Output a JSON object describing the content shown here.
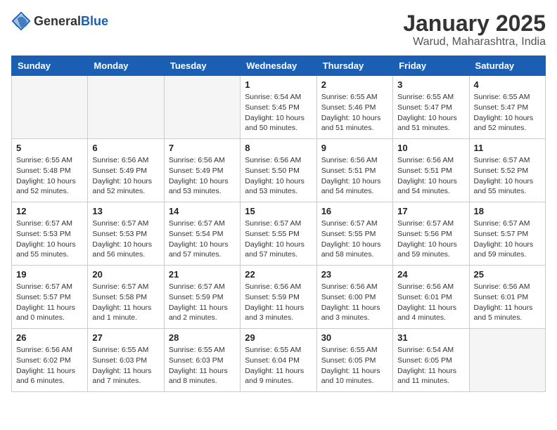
{
  "header": {
    "logo_general": "General",
    "logo_blue": "Blue",
    "title": "January 2025",
    "subtitle": "Warud, Maharashtra, India"
  },
  "weekdays": [
    "Sunday",
    "Monday",
    "Tuesday",
    "Wednesday",
    "Thursday",
    "Friday",
    "Saturday"
  ],
  "weeks": [
    [
      {
        "day": "",
        "info": ""
      },
      {
        "day": "",
        "info": ""
      },
      {
        "day": "",
        "info": ""
      },
      {
        "day": "1",
        "info": "Sunrise: 6:54 AM\nSunset: 5:45 PM\nDaylight: 10 hours\nand 50 minutes."
      },
      {
        "day": "2",
        "info": "Sunrise: 6:55 AM\nSunset: 5:46 PM\nDaylight: 10 hours\nand 51 minutes."
      },
      {
        "day": "3",
        "info": "Sunrise: 6:55 AM\nSunset: 5:47 PM\nDaylight: 10 hours\nand 51 minutes."
      },
      {
        "day": "4",
        "info": "Sunrise: 6:55 AM\nSunset: 5:47 PM\nDaylight: 10 hours\nand 52 minutes."
      }
    ],
    [
      {
        "day": "5",
        "info": "Sunrise: 6:55 AM\nSunset: 5:48 PM\nDaylight: 10 hours\nand 52 minutes."
      },
      {
        "day": "6",
        "info": "Sunrise: 6:56 AM\nSunset: 5:49 PM\nDaylight: 10 hours\nand 52 minutes."
      },
      {
        "day": "7",
        "info": "Sunrise: 6:56 AM\nSunset: 5:49 PM\nDaylight: 10 hours\nand 53 minutes."
      },
      {
        "day": "8",
        "info": "Sunrise: 6:56 AM\nSunset: 5:50 PM\nDaylight: 10 hours\nand 53 minutes."
      },
      {
        "day": "9",
        "info": "Sunrise: 6:56 AM\nSunset: 5:51 PM\nDaylight: 10 hours\nand 54 minutes."
      },
      {
        "day": "10",
        "info": "Sunrise: 6:56 AM\nSunset: 5:51 PM\nDaylight: 10 hours\nand 54 minutes."
      },
      {
        "day": "11",
        "info": "Sunrise: 6:57 AM\nSunset: 5:52 PM\nDaylight: 10 hours\nand 55 minutes."
      }
    ],
    [
      {
        "day": "12",
        "info": "Sunrise: 6:57 AM\nSunset: 5:53 PM\nDaylight: 10 hours\nand 55 minutes."
      },
      {
        "day": "13",
        "info": "Sunrise: 6:57 AM\nSunset: 5:53 PM\nDaylight: 10 hours\nand 56 minutes."
      },
      {
        "day": "14",
        "info": "Sunrise: 6:57 AM\nSunset: 5:54 PM\nDaylight: 10 hours\nand 57 minutes."
      },
      {
        "day": "15",
        "info": "Sunrise: 6:57 AM\nSunset: 5:55 PM\nDaylight: 10 hours\nand 57 minutes."
      },
      {
        "day": "16",
        "info": "Sunrise: 6:57 AM\nSunset: 5:55 PM\nDaylight: 10 hours\nand 58 minutes."
      },
      {
        "day": "17",
        "info": "Sunrise: 6:57 AM\nSunset: 5:56 PM\nDaylight: 10 hours\nand 59 minutes."
      },
      {
        "day": "18",
        "info": "Sunrise: 6:57 AM\nSunset: 5:57 PM\nDaylight: 10 hours\nand 59 minutes."
      }
    ],
    [
      {
        "day": "19",
        "info": "Sunrise: 6:57 AM\nSunset: 5:57 PM\nDaylight: 11 hours\nand 0 minutes."
      },
      {
        "day": "20",
        "info": "Sunrise: 6:57 AM\nSunset: 5:58 PM\nDaylight: 11 hours\nand 1 minute."
      },
      {
        "day": "21",
        "info": "Sunrise: 6:57 AM\nSunset: 5:59 PM\nDaylight: 11 hours\nand 2 minutes."
      },
      {
        "day": "22",
        "info": "Sunrise: 6:56 AM\nSunset: 5:59 PM\nDaylight: 11 hours\nand 3 minutes."
      },
      {
        "day": "23",
        "info": "Sunrise: 6:56 AM\nSunset: 6:00 PM\nDaylight: 11 hours\nand 3 minutes."
      },
      {
        "day": "24",
        "info": "Sunrise: 6:56 AM\nSunset: 6:01 PM\nDaylight: 11 hours\nand 4 minutes."
      },
      {
        "day": "25",
        "info": "Sunrise: 6:56 AM\nSunset: 6:01 PM\nDaylight: 11 hours\nand 5 minutes."
      }
    ],
    [
      {
        "day": "26",
        "info": "Sunrise: 6:56 AM\nSunset: 6:02 PM\nDaylight: 11 hours\nand 6 minutes."
      },
      {
        "day": "27",
        "info": "Sunrise: 6:55 AM\nSunset: 6:03 PM\nDaylight: 11 hours\nand 7 minutes."
      },
      {
        "day": "28",
        "info": "Sunrise: 6:55 AM\nSunset: 6:03 PM\nDaylight: 11 hours\nand 8 minutes."
      },
      {
        "day": "29",
        "info": "Sunrise: 6:55 AM\nSunset: 6:04 PM\nDaylight: 11 hours\nand 9 minutes."
      },
      {
        "day": "30",
        "info": "Sunrise: 6:55 AM\nSunset: 6:05 PM\nDaylight: 11 hours\nand 10 minutes."
      },
      {
        "day": "31",
        "info": "Sunrise: 6:54 AM\nSunset: 6:05 PM\nDaylight: 11 hours\nand 11 minutes."
      },
      {
        "day": "",
        "info": ""
      }
    ]
  ]
}
